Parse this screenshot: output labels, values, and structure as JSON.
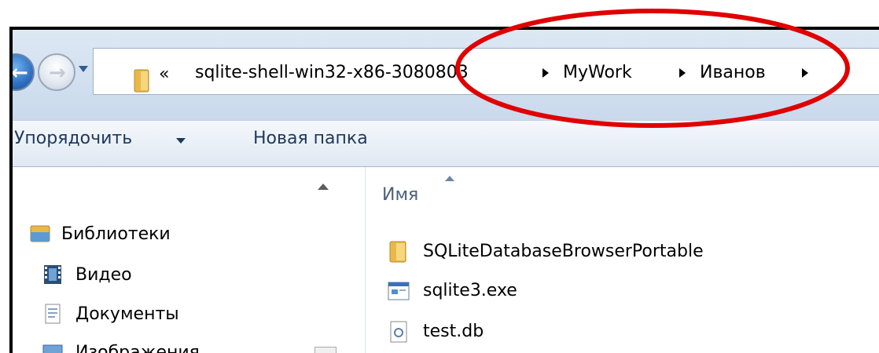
{
  "address_bar": {
    "overflow_label": "«",
    "breadcrumbs": [
      "sqlite-shell-win32-x86-3080803",
      "MyWork",
      "Иванов"
    ]
  },
  "toolbar": {
    "organize_label": "Упорядочить",
    "new_folder_label": "Новая папка"
  },
  "nav_pane": {
    "items": [
      {
        "label": "Библиотеки",
        "icon": "libraries-icon"
      },
      {
        "label": "Видео",
        "icon": "video-icon"
      },
      {
        "label": "Документы",
        "icon": "documents-icon"
      },
      {
        "label": "Изображения",
        "icon": "images-icon"
      }
    ]
  },
  "file_list": {
    "column_name": "Имя",
    "items": [
      {
        "name": "SQLiteDatabaseBrowserPortable",
        "icon": "folder-icon"
      },
      {
        "name": "sqlite3.exe",
        "icon": "exe-icon"
      },
      {
        "name": "test.db",
        "icon": "file-icon"
      }
    ]
  },
  "colors": {
    "highlight": "#e00000",
    "nav_text": "#1e395b"
  }
}
